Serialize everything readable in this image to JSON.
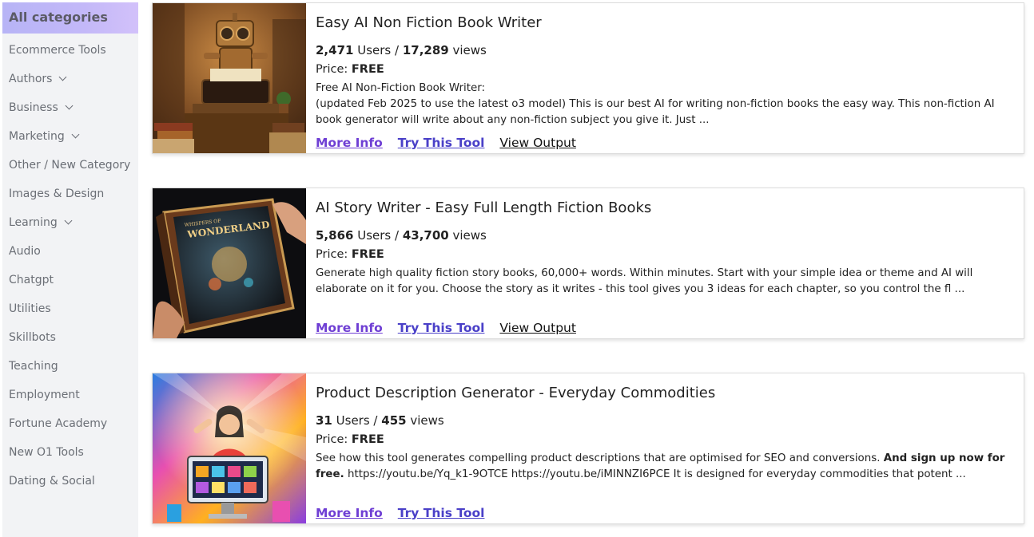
{
  "sidebar": {
    "active": "All categories",
    "items": [
      {
        "label": "Ecommerce Tools",
        "chevron": false
      },
      {
        "label": "Authors",
        "chevron": true
      },
      {
        "label": "Business",
        "chevron": true
      },
      {
        "label": "Marketing",
        "chevron": true
      },
      {
        "label": "Other / New Category",
        "chevron": false
      },
      {
        "label": "Images & Design",
        "chevron": false
      },
      {
        "label": "Learning",
        "chevron": true
      },
      {
        "label": "Audio",
        "chevron": false
      },
      {
        "label": "Chatgpt",
        "chevron": false
      },
      {
        "label": "Utilities",
        "chevron": false
      },
      {
        "label": "Skillbots",
        "chevron": false
      },
      {
        "label": "Teaching",
        "chevron": false
      },
      {
        "label": "Employment",
        "chevron": false
      },
      {
        "label": "Fortune Academy",
        "chevron": false
      },
      {
        "label": "New O1 Tools",
        "chevron": false
      },
      {
        "label": "Dating & Social",
        "chevron": false
      }
    ]
  },
  "cards": [
    {
      "title": "Easy AI Non Fiction Book Writer",
      "users": "2,471",
      "users_label": "Users /",
      "views": "17,289",
      "views_label": "views",
      "price_label": "Price:",
      "price": "FREE",
      "desc_line1": "Free AI Non-Fiction Book Writer:",
      "desc_line2": "(updated Feb 2025 to use the latest o3 model) This is our best AI for writing non-fiction books the easy way. This non-fiction AI book generator will write about any non-fiction subject you give it. Just ...",
      "more_info": "More Info",
      "try_tool": "Try This Tool",
      "view_output": "View Output",
      "image_icon": "robot-typewriter-image"
    },
    {
      "title": "AI Story Writer - Easy Full Length Fiction Books",
      "users": "5,866",
      "users_label": "Users /",
      "views": "43,700",
      "views_label": "views",
      "price_label": "Price:",
      "price": "FREE",
      "desc": "Generate high quality fiction story books, 60,000+ words. Within minutes. Start with your simple idea or theme and AI will elaborate on it for you. Choose the story as it writes - this tool gives you 3 ideas for each chapter, so you control the fl ...",
      "book_title": "WONDERLAND",
      "book_subtitle": "WHISPERS OF",
      "more_info": "More Info",
      "try_tool": "Try This Tool",
      "view_output": "View Output",
      "image_icon": "storybook-image"
    },
    {
      "title": "Product Description Generator - Everyday Commodities",
      "users": "31",
      "users_label": "Users /",
      "views": "455",
      "views_label": "views",
      "price_label": "Price:",
      "price": "FREE",
      "desc_start": "See how this tool generates compelling product descriptions that are optimised for SEO and conversions.",
      "desc_bold": "And sign up now for free.",
      "desc_end": "https://youtu.be/Yq_k1-9OTCE https://youtu.be/iMINNZI6PCE It is designed for everyday commodities that potent ...",
      "more_info": "More Info",
      "try_tool": "Try This Tool",
      "image_icon": "shopping-celebration-image"
    }
  ],
  "colors": {
    "active_gradient_start": "#b7b4f6",
    "active_gradient_end": "#d2c1fa",
    "more_info": "#6f3fd4",
    "try_tool": "#4a40c8",
    "sidebar_bg": "#f2f3f5"
  }
}
